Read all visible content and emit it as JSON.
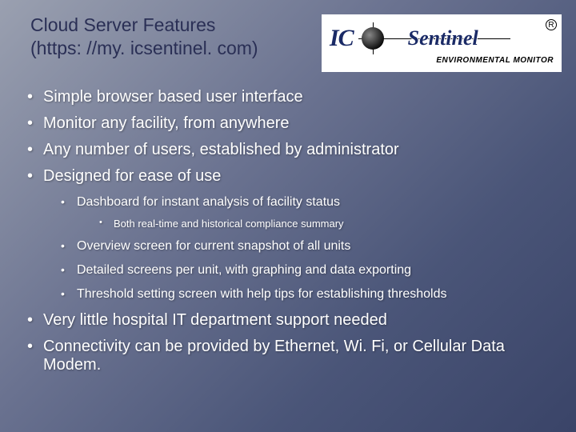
{
  "header": {
    "title_line1": "Cloud Server Features",
    "title_line2": "(https: //my. icsentinel. com)"
  },
  "logo": {
    "ic": "IC",
    "sentinel": "Sentinel",
    "reg": "R",
    "tagline": "ENVIRONMENTAL MONITOR"
  },
  "bullets": [
    "Simple browser based user interface",
    "Monitor any facility, from anywhere",
    "Any number of users, established by administrator",
    "Designed for ease of use",
    "Very little hospital IT department support needed",
    "Connectivity can be provided by Ethernet, Wi. Fi, or Cellular Data Modem."
  ],
  "sub1": [
    "Dashboard for instant analysis of facility status",
    "Overview screen for current snapshot of all units",
    "Detailed screens per unit, with graphing and data exporting",
    "Threshold setting screen with help tips for establishing thresholds"
  ],
  "sub2": [
    "Both real-time and historical compliance summary"
  ]
}
